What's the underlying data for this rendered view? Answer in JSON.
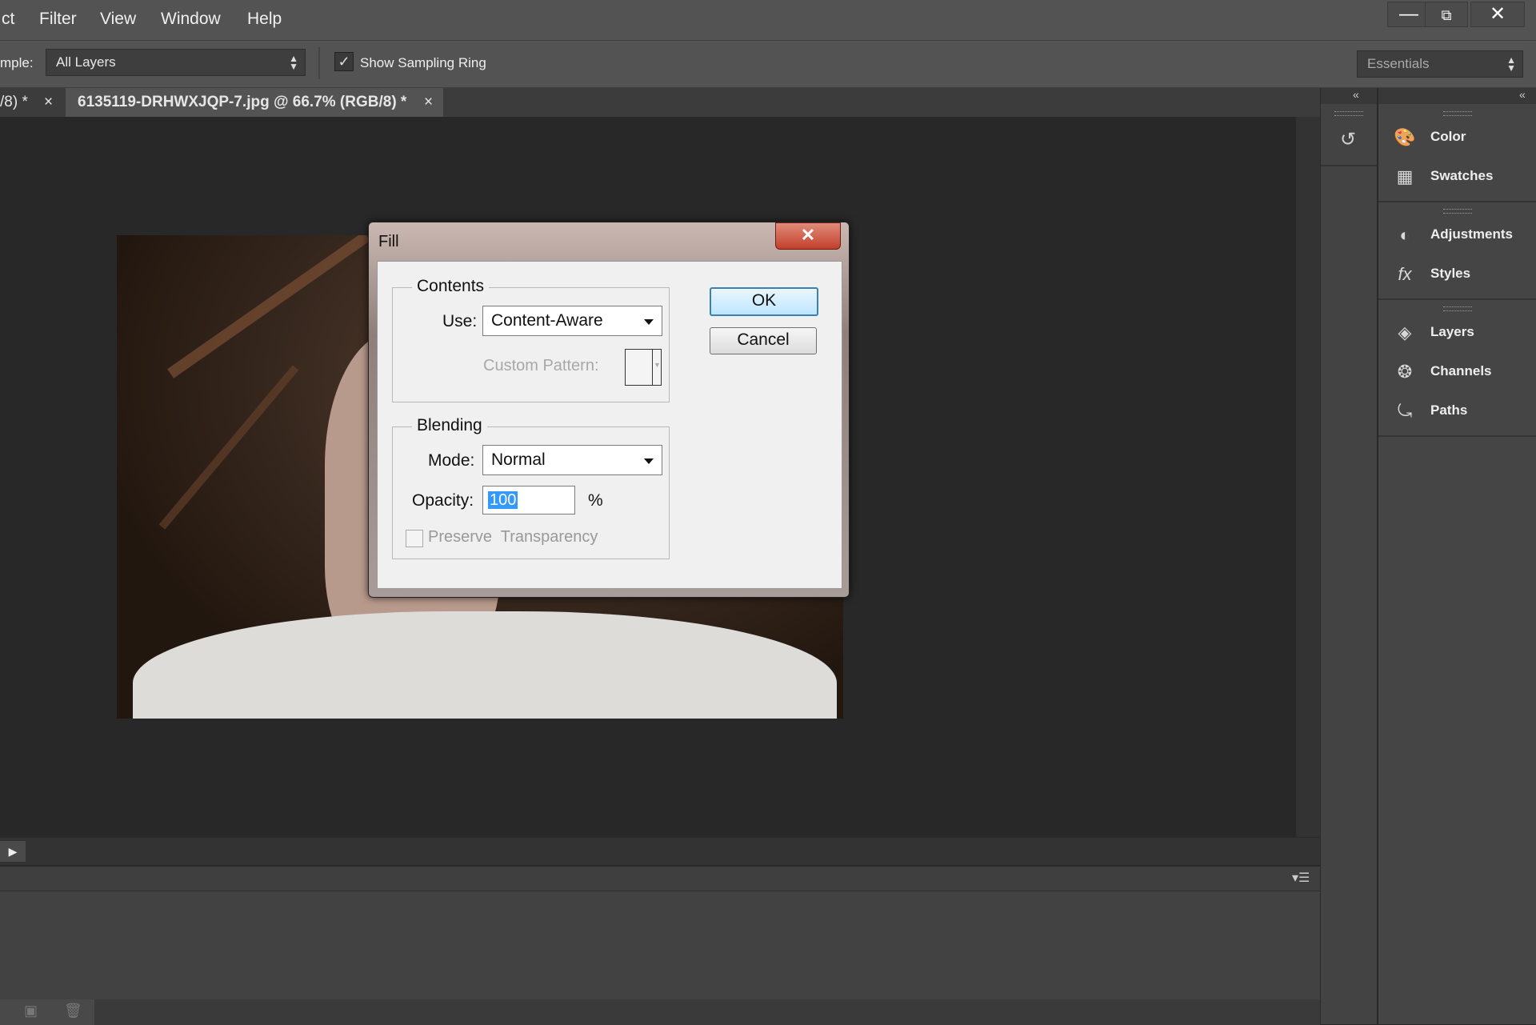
{
  "menubar": {
    "items": [
      "ct",
      "Filter",
      "View",
      "Window",
      "Help"
    ],
    "window_controls": [
      "minimize",
      "restore",
      "close"
    ]
  },
  "options": {
    "sample_label": "mple:",
    "sample_value": "All Layers",
    "show_sampling_ring_label": "Show Sampling Ring",
    "show_sampling_ring_checked": true,
    "workspace": "Essentials"
  },
  "tabs": {
    "prev_tab": "/8) *",
    "active_tab": "6135119-DRHWXJQP-7.jpg @ 66.7% (RGB/8) *",
    "close_glyph": "×"
  },
  "panels": {
    "items": [
      {
        "label": "Color",
        "icon": "color-palette-icon"
      },
      {
        "label": "Swatches",
        "icon": "swatches-grid-icon"
      },
      {
        "label": "Adjustments",
        "icon": "adjustments-icon"
      },
      {
        "label": "Styles",
        "icon": "styles-fx-icon"
      },
      {
        "label": "Layers",
        "icon": "layers-icon"
      },
      {
        "label": "Channels",
        "icon": "channels-icon"
      },
      {
        "label": "Paths",
        "icon": "paths-icon"
      }
    ]
  },
  "dialog": {
    "title": "Fill",
    "close_glyph": "✕",
    "contents_legend": "Contents",
    "use_label": "Use:",
    "use_value": "Content-Aware",
    "custom_pattern_label": "Custom Pattern:",
    "blending_legend": "Blending",
    "mode_label": "Mode:",
    "mode_value": "Normal",
    "opacity_label": "Opacity:",
    "opacity_value": "100",
    "opacity_unit": "%",
    "preserve_label": "Preserve  Transparency",
    "preserve_checked": false,
    "ok_label": "OK",
    "cancel_label": "Cancel"
  },
  "colors": {
    "accent": "#3c7fb1",
    "selection": "#3399ff",
    "close_red": "#c2402b"
  }
}
